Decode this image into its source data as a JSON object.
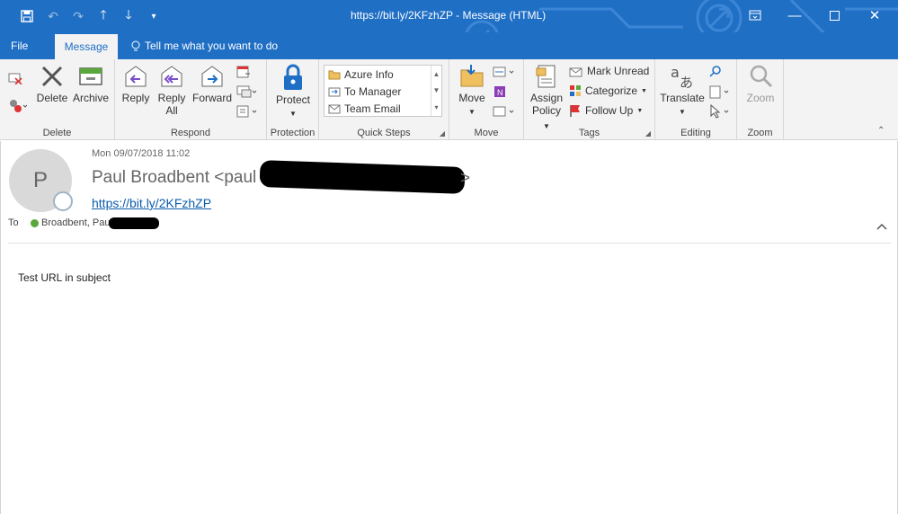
{
  "window": {
    "title": "https://bit.ly/2KFzhZP  -  Message (HTML)",
    "controls": [
      "restore-ribbon",
      "minimize",
      "maximize",
      "close"
    ]
  },
  "menu": {
    "file": "File",
    "message": "Message",
    "tell_me": "Tell me what you want to do"
  },
  "ribbon": {
    "groups": {
      "delete": "Delete",
      "respond": "Respond",
      "protection": "Protection",
      "quick_steps": "Quick Steps",
      "move": "Move",
      "tags": "Tags",
      "editing": "Editing",
      "zoom": "Zoom"
    },
    "buttons": {
      "delete": "Delete",
      "archive": "Archive",
      "reply": "Reply",
      "reply_all_1": "Reply",
      "reply_all_2": "All",
      "forward": "Forward",
      "protect": "Protect",
      "move": "Move",
      "assign_1": "Assign",
      "assign_2": "Policy",
      "mark_unread": "Mark Unread",
      "categorize": "Categorize",
      "follow_up": "Follow Up",
      "translate": "Translate",
      "zoom": "Zoom"
    },
    "quick_steps": [
      "Azure Info",
      "To Manager",
      "Team Email"
    ]
  },
  "message": {
    "avatar_initial": "P",
    "date": "Mon 09/07/2018 11:02",
    "sender_name": "Paul Broadbent <paul",
    "sender_end": ">",
    "subject_link": "https://bit.ly/2KFzhZP",
    "to_label": "To",
    "recipient": "Broadbent, Paul",
    "body": "Test URL in subject"
  },
  "colors": {
    "accent": "#1f6fc5",
    "ribbon_bg": "#f3f3f3",
    "link": "#0b5cad",
    "presence": "#5aa83b"
  }
}
